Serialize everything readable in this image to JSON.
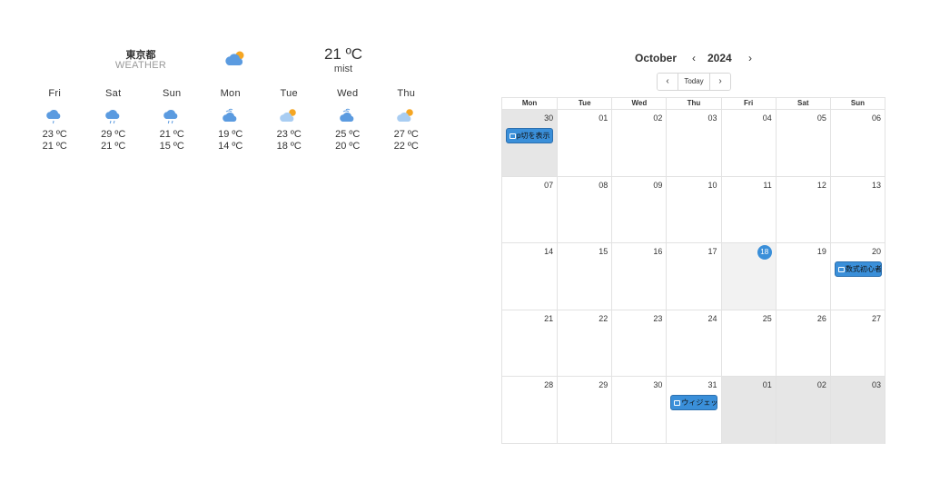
{
  "weather": {
    "city": "東京都",
    "caption": "WEATHER",
    "current": {
      "temp": "21 ºC",
      "condition": "mist",
      "icon": "partly-cloudy-day-icon"
    },
    "days": [
      {
        "name": "Fri",
        "icon": "drizzle-icon",
        "high": "23 ºC",
        "low": "21 ºC"
      },
      {
        "name": "Sat",
        "icon": "rain-icon",
        "high": "29 ºC",
        "low": "21 ºC"
      },
      {
        "name": "Sun",
        "icon": "rain-icon",
        "high": "21 ºC",
        "low": "15 ºC"
      },
      {
        "name": "Mon",
        "icon": "windy-cloud-icon",
        "high": "19 ºC",
        "low": "14 ºC"
      },
      {
        "name": "Tue",
        "icon": "partly-cloudy-day-icon",
        "high": "23 ºC",
        "low": "18 ºC"
      },
      {
        "name": "Wed",
        "icon": "windy-cloud-icon",
        "high": "25 ºC",
        "low": "20 ºC"
      },
      {
        "name": "Thu",
        "icon": "partly-cloudy-day-icon",
        "high": "27 ºC",
        "low": "22 ºC"
      }
    ],
    "colors": {
      "cloud": "#5b9be0",
      "cloud_light": "#a9cdf2",
      "sun": "#f5a623",
      "rain": "#5b9be0"
    }
  },
  "calendar": {
    "month": "October",
    "year": "2024",
    "prev_year": "‹",
    "next_year": "›",
    "nav": {
      "prev": "‹",
      "today": "Today",
      "next": "›"
    },
    "weekdays": [
      "Mon",
      "Tue",
      "Wed",
      "Thu",
      "Fri",
      "Sat",
      "Sun"
    ],
    "weeks": [
      [
        {
          "n": "30",
          "other": true,
          "events": [
            {
              "title": "p切を表示"
            }
          ]
        },
        {
          "n": "01"
        },
        {
          "n": "02"
        },
        {
          "n": "03"
        },
        {
          "n": "04"
        },
        {
          "n": "05"
        },
        {
          "n": "06"
        }
      ],
      [
        {
          "n": "07"
        },
        {
          "n": "08"
        },
        {
          "n": "09"
        },
        {
          "n": "10"
        },
        {
          "n": "11"
        },
        {
          "n": "12"
        },
        {
          "n": "13"
        }
      ],
      [
        {
          "n": "14"
        },
        {
          "n": "15"
        },
        {
          "n": "16"
        },
        {
          "n": "17"
        },
        {
          "n": "18",
          "today": true
        },
        {
          "n": "19"
        },
        {
          "n": "20",
          "events": [
            {
              "title": "数式初心者"
            }
          ]
        }
      ],
      [
        {
          "n": "21"
        },
        {
          "n": "22"
        },
        {
          "n": "23"
        },
        {
          "n": "24"
        },
        {
          "n": "25"
        },
        {
          "n": "26"
        },
        {
          "n": "27"
        }
      ],
      [
        {
          "n": "28"
        },
        {
          "n": "29"
        },
        {
          "n": "30"
        },
        {
          "n": "31",
          "events": [
            {
              "title": "ウィジェット"
            }
          ]
        },
        {
          "n": "01",
          "other": true
        },
        {
          "n": "02",
          "other": true
        },
        {
          "n": "03",
          "other": true
        }
      ]
    ],
    "colors": {
      "accent": "#3a8fd9",
      "event_bg": "#3a8fd9",
      "other_month_bg": "#e6e6e6",
      "today_bg": "#f2f2f2"
    }
  }
}
